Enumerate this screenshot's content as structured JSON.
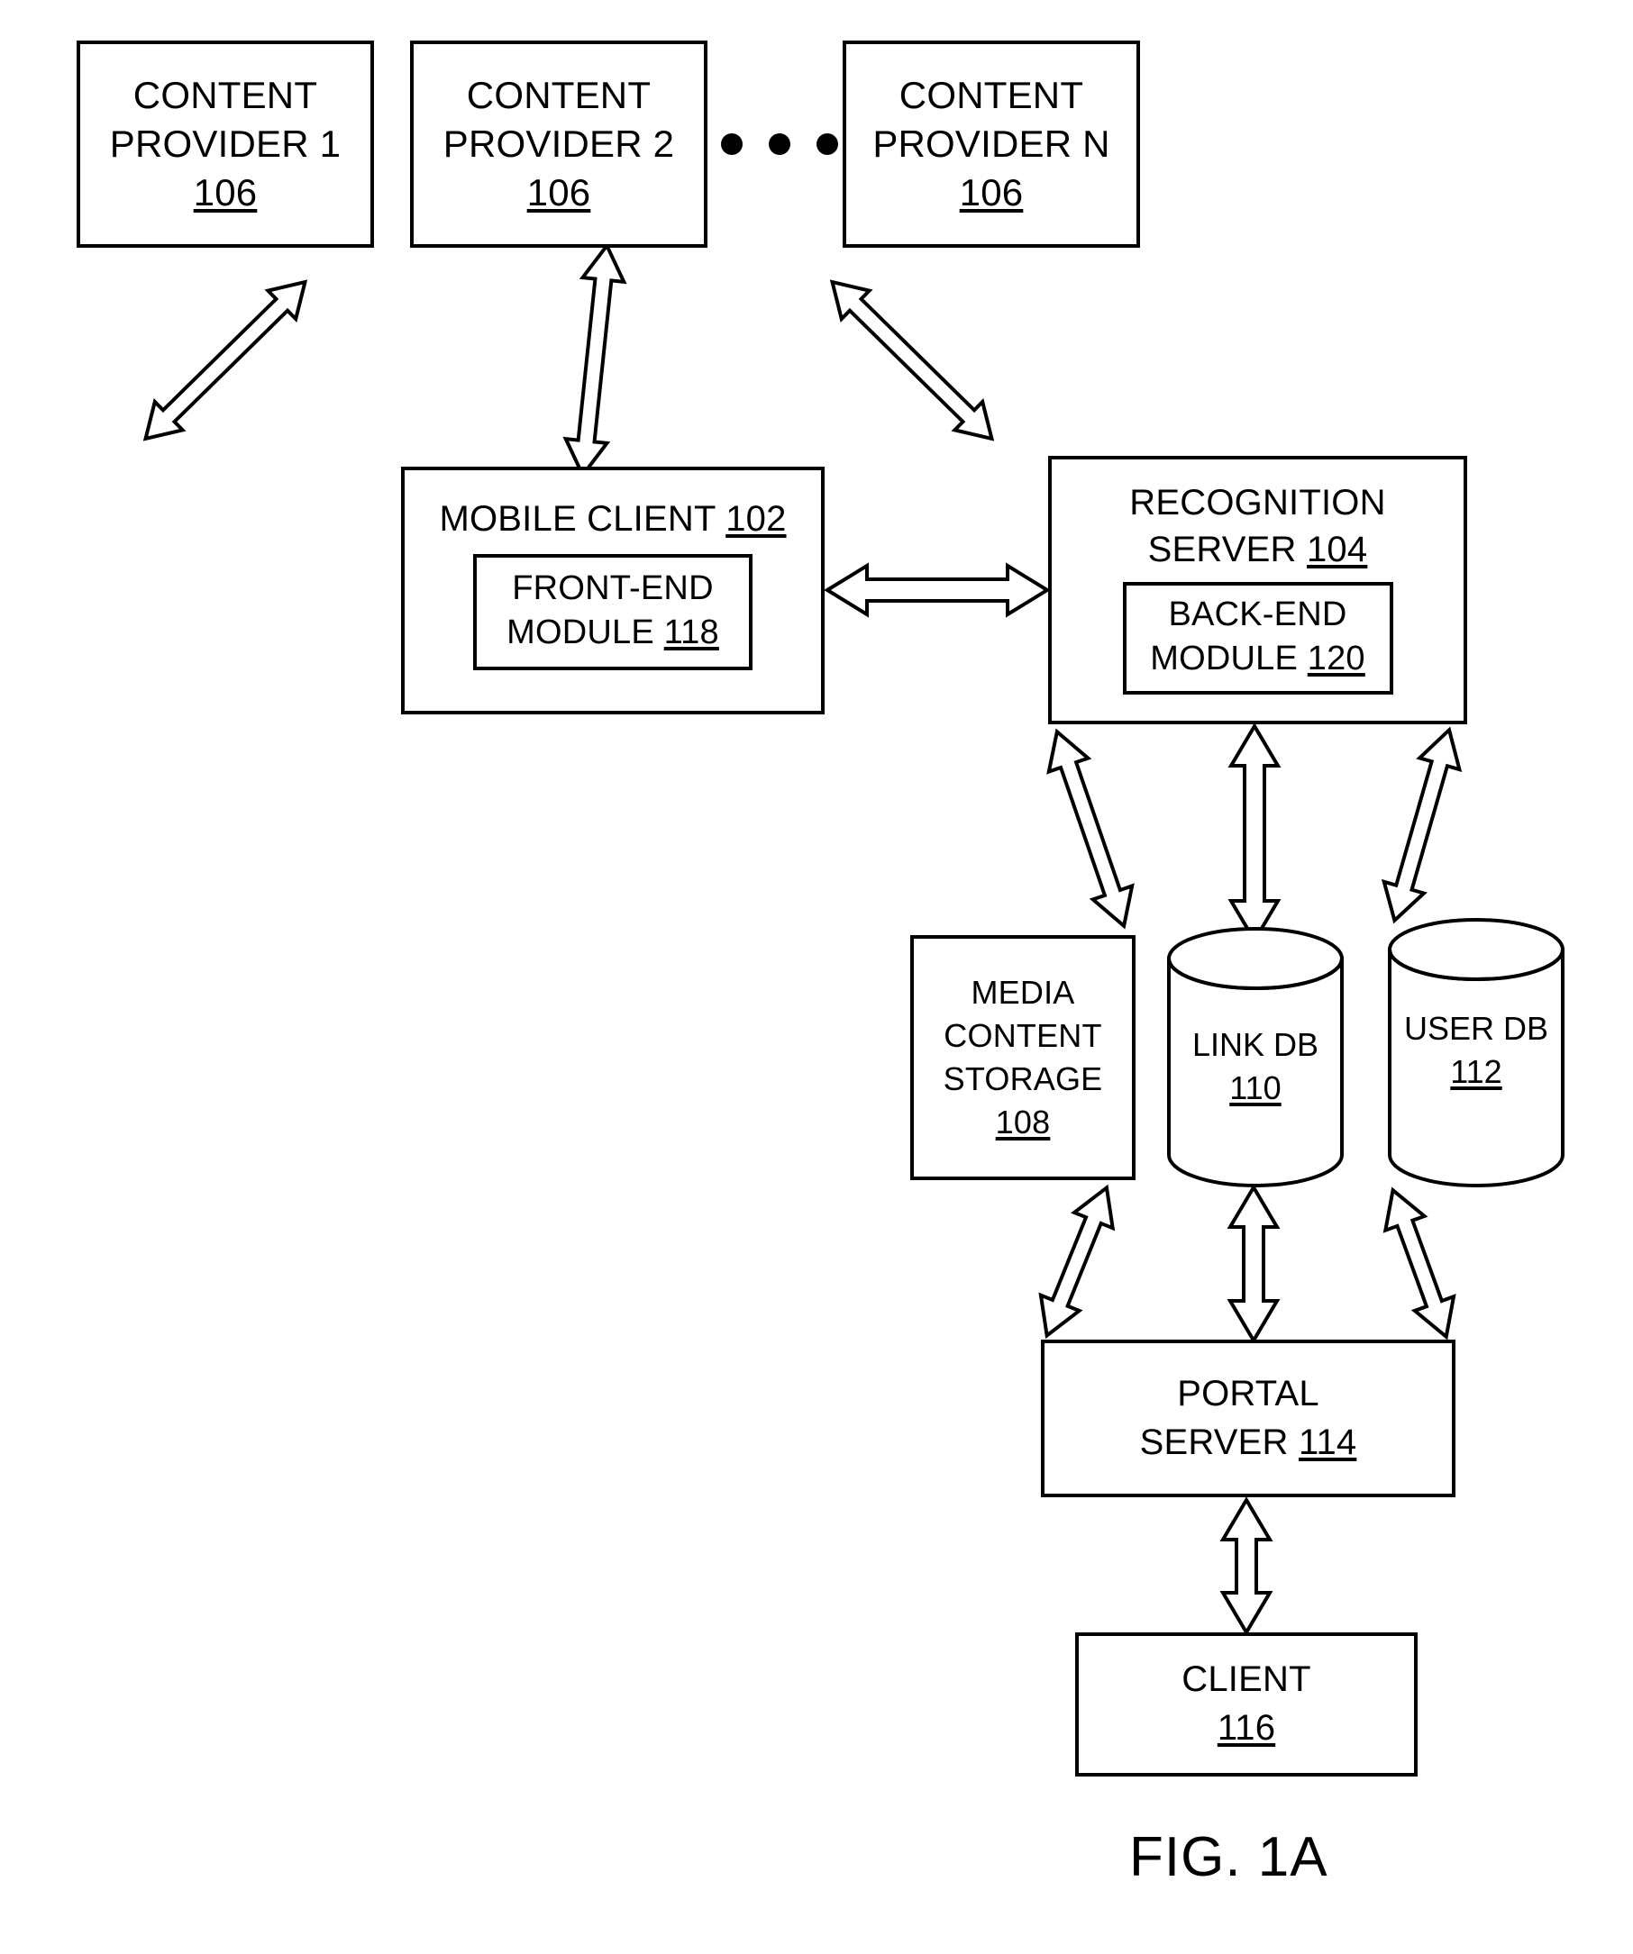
{
  "figure": {
    "caption": "FIG. 1A",
    "ink_color": "#000000",
    "background_color": "#ffffff"
  },
  "providers": [
    {
      "line1": "CONTENT",
      "line2": "PROVIDER 1",
      "ref": "106"
    },
    {
      "line1": "CONTENT",
      "line2": "PROVIDER 2",
      "ref": "106"
    },
    {
      "line1": "CONTENT",
      "line2": "PROVIDER N",
      "ref": "106"
    }
  ],
  "ellipsis": {
    "dots": 3
  },
  "mobile_client": {
    "title": "MOBILE CLIENT",
    "ref": "102",
    "module": {
      "line1": "FRONT-END",
      "line2": "MODULE",
      "ref": "118"
    }
  },
  "recognition_server": {
    "line1": "RECOGNITION",
    "line2": "SERVER",
    "ref": "104",
    "module": {
      "line1": "BACK-END",
      "line2": "MODULE",
      "ref": "120"
    }
  },
  "media_content_storage": {
    "line1": "MEDIA",
    "line2": "CONTENT",
    "line3": "STORAGE",
    "ref": "108"
  },
  "link_db": {
    "label": "LINK DB",
    "ref": "110"
  },
  "user_db": {
    "label": "USER DB",
    "ref": "112"
  },
  "portal_server": {
    "line1": "PORTAL",
    "line2": "SERVER",
    "ref": "114"
  },
  "client": {
    "label": "CLIENT",
    "ref": "116"
  },
  "connections": [
    {
      "from": "content-provider-1",
      "to": "mobile-client",
      "style": "double-headed-hollow"
    },
    {
      "from": "content-provider-2",
      "to": "mobile-client",
      "style": "double-headed-hollow"
    },
    {
      "from": "content-provider-n",
      "to": "mobile-client",
      "style": "double-headed-hollow"
    },
    {
      "from": "mobile-client",
      "to": "recognition-server",
      "style": "double-headed-hollow"
    },
    {
      "from": "recognition-server",
      "to": "media-content-storage",
      "style": "double-headed-hollow"
    },
    {
      "from": "recognition-server",
      "to": "link-db",
      "style": "double-headed-hollow"
    },
    {
      "from": "recognition-server",
      "to": "user-db",
      "style": "double-headed-hollow"
    },
    {
      "from": "media-content-storage",
      "to": "portal-server",
      "style": "double-headed-hollow"
    },
    {
      "from": "link-db",
      "to": "portal-server",
      "style": "double-headed-hollow"
    },
    {
      "from": "user-db",
      "to": "portal-server",
      "style": "double-headed-hollow"
    },
    {
      "from": "portal-server",
      "to": "client",
      "style": "double-headed-hollow"
    }
  ]
}
